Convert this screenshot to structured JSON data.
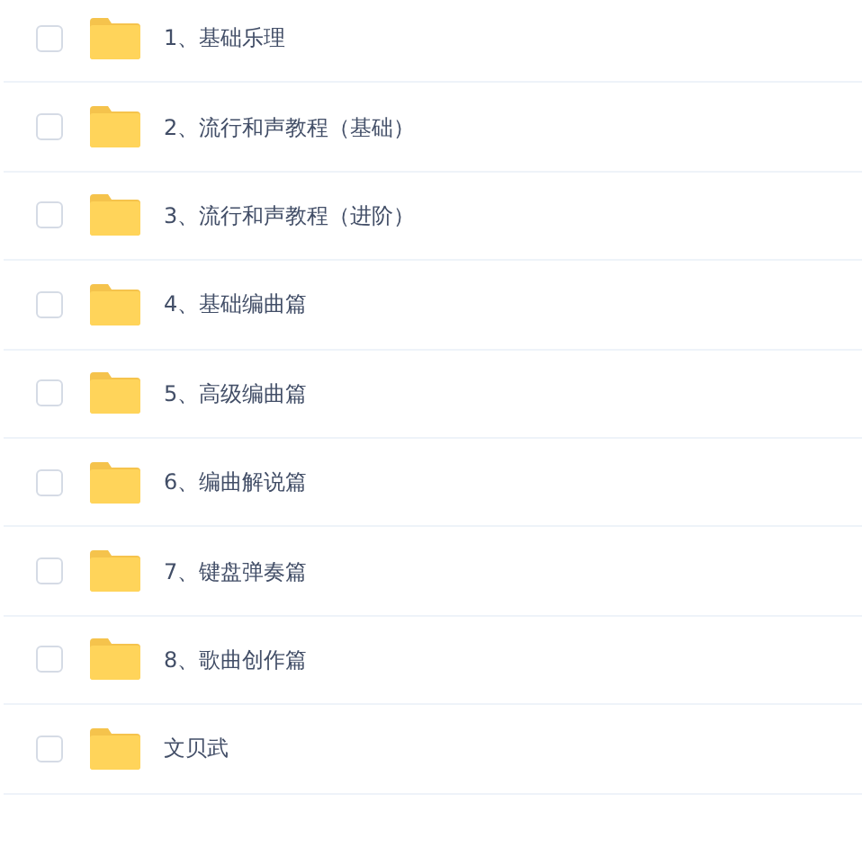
{
  "files": [
    {
      "name": "1、基础乐理",
      "checked": false
    },
    {
      "name": "2、流行和声教程（基础）",
      "checked": false
    },
    {
      "name": "3、流行和声教程（进阶）",
      "checked": false
    },
    {
      "name": "4、基础编曲篇",
      "checked": false
    },
    {
      "name": "5、高级编曲篇",
      "checked": false
    },
    {
      "name": "6、编曲解说篇",
      "checked": false
    },
    {
      "name": "7、键盘弹奏篇",
      "checked": false
    },
    {
      "name": "8、歌曲创作篇",
      "checked": false
    },
    {
      "name": "文贝武",
      "checked": false
    }
  ]
}
